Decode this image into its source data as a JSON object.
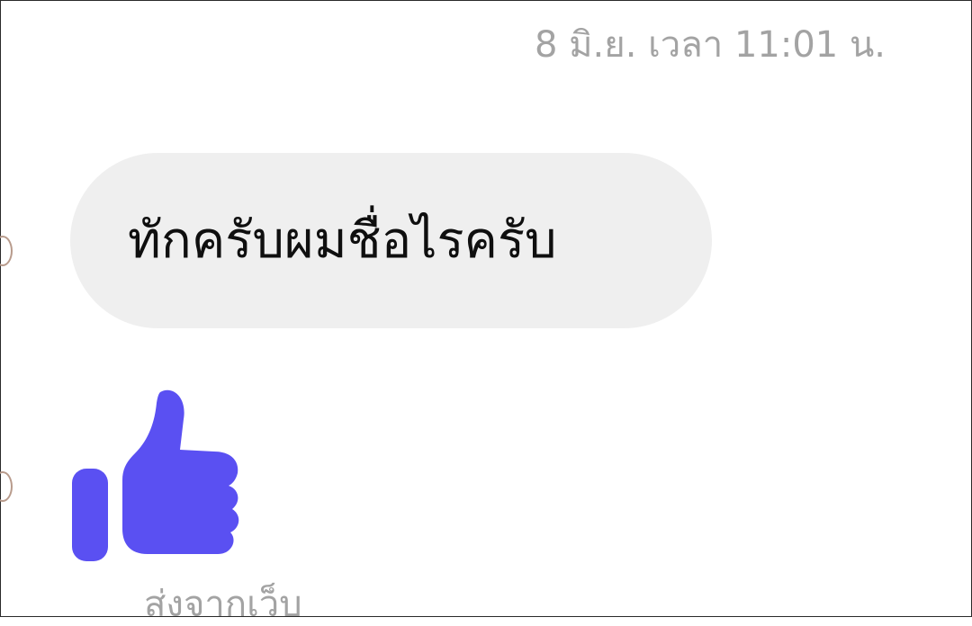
{
  "conversation": {
    "timestamp": "8 มิ.ย. เวลา 11:01 น.",
    "messages": [
      {
        "type": "text",
        "text": "ทักครับผมชื่อไรครับ"
      },
      {
        "type": "like",
        "icon": "thumbs-up-icon",
        "color": "#5a50f2"
      }
    ],
    "sender_note": "ส่งจากเว็บ"
  }
}
